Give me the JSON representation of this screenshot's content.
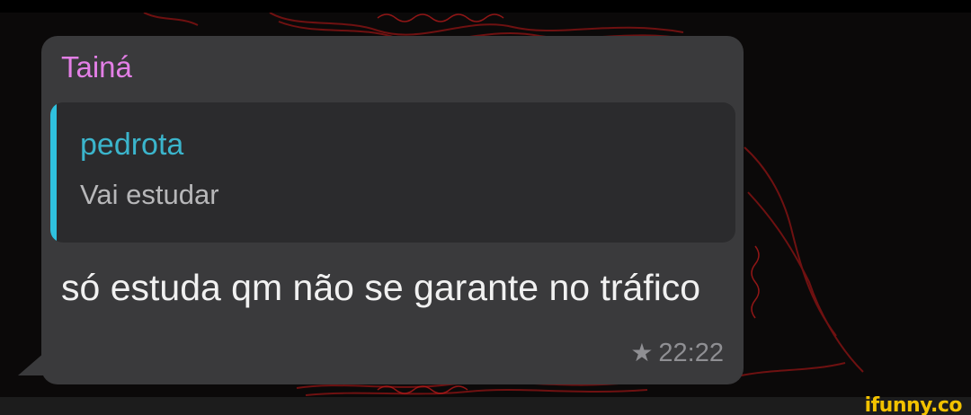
{
  "message": {
    "sender_name": "Tainá",
    "reply": {
      "author": "pedrota",
      "text": "Vai estudar"
    },
    "text": "só estuda qm não se garante no tráfico",
    "time": "22:22",
    "starred_icon": "star-icon"
  },
  "watermark": "ifunny.co",
  "colors": {
    "sender_name": "#e37fe6",
    "reply_author": "#3bb5cc",
    "reply_bar": "#2fc1de",
    "bubble": "#3a3a3c",
    "watermark": "#f2c200"
  }
}
